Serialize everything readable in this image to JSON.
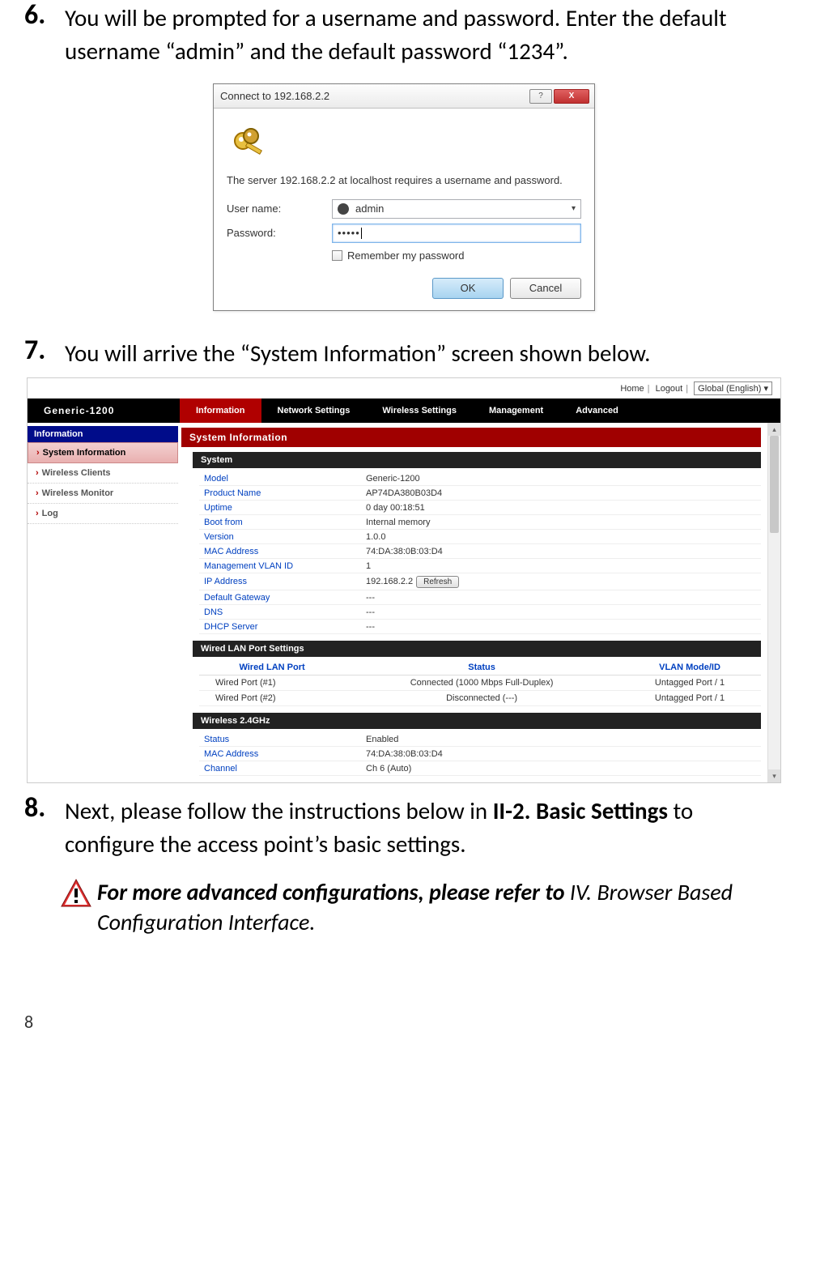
{
  "step6": {
    "num": "6.",
    "text": "You will be prompted for a username and password. Enter the default username “admin” and the default password “1234”."
  },
  "dialog": {
    "title": "Connect to 192.168.2.2",
    "help": "?",
    "close": "X",
    "server_text": "The server 192.168.2.2 at localhost requires a username and password.",
    "user_label": "User name:",
    "user_value": "admin",
    "pw_label": "Password:",
    "pw_value": "•••••",
    "remember": "Remember my password",
    "ok": "OK",
    "cancel": "Cancel"
  },
  "step7": {
    "num": "7.",
    "text": "You will arrive the “System Information” screen shown below."
  },
  "router": {
    "toplinks": {
      "home": "Home",
      "logout": "Logout",
      "lang": "Global (English)"
    },
    "brand": "Generic-1200",
    "tabs": [
      "Information",
      "Network Settings",
      "Wireless Settings",
      "Management",
      "Advanced"
    ],
    "sidebar": {
      "head": "Information",
      "items": [
        "System Information",
        "Wireless Clients",
        "Wireless Monitor",
        "Log"
      ]
    },
    "panel_title": "System Information",
    "system_bar": "System",
    "sys": [
      {
        "k": "Model",
        "v": "Generic-1200"
      },
      {
        "k": "Product Name",
        "v": "AP74DA380B03D4"
      },
      {
        "k": "Uptime",
        "v": "0 day 00:18:51"
      },
      {
        "k": "Boot from",
        "v": "Internal memory"
      },
      {
        "k": "Version",
        "v": "1.0.0"
      },
      {
        "k": "MAC Address",
        "v": "74:DA:38:0B:03:D4"
      },
      {
        "k": "Management VLAN ID",
        "v": "1"
      },
      {
        "k": "IP Address",
        "v": "192.168.2.2"
      },
      {
        "k": "Default Gateway",
        "v": "---"
      },
      {
        "k": "DNS",
        "v": "---"
      },
      {
        "k": "DHCP Server",
        "v": "---"
      }
    ],
    "refresh": "Refresh",
    "lan_bar": "Wired LAN Port Settings",
    "lan_headers": [
      "Wired LAN Port",
      "Status",
      "VLAN Mode/ID"
    ],
    "lan_rows": [
      {
        "port": "Wired Port (#1)",
        "status": "Connected (1000 Mbps Full-Duplex)",
        "vlan": "Untagged Port  /   1"
      },
      {
        "port": "Wired Port (#2)",
        "status": "Disconnected (---)",
        "vlan": "Untagged Port  /   1"
      }
    ],
    "w24_bar": "Wireless 2.4GHz",
    "w24": [
      {
        "k": "Status",
        "v": "Enabled"
      },
      {
        "k": "MAC Address",
        "v": "74:DA:38:0B:03:D4"
      },
      {
        "k": "Channel",
        "v": "Ch 6 (Auto)"
      }
    ]
  },
  "step8": {
    "num": "8.",
    "text_a": "Next, please follow the instructions below in ",
    "text_bold": "II-2. Basic Settings",
    "text_b": " to configure the access point’s basic settings."
  },
  "note": {
    "bold": "For more advanced configurations, please refer to ",
    "italic": "IV. Browser Based Configuration Interface."
  },
  "pagenum": "8"
}
